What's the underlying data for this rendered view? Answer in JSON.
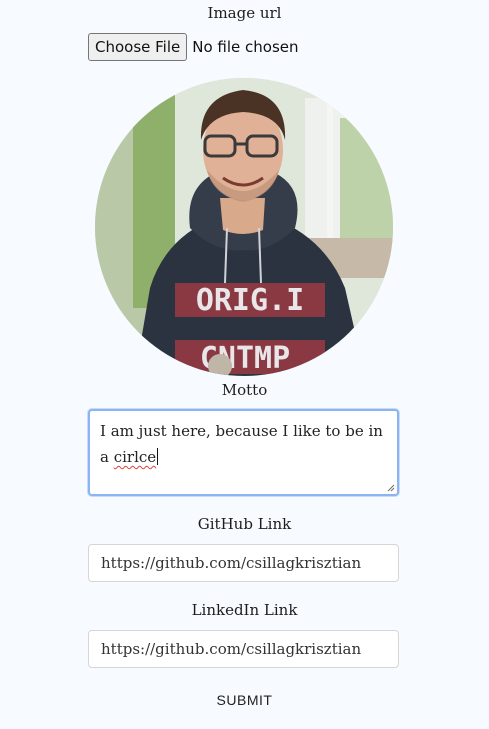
{
  "image_field": {
    "label": "Image url",
    "button_label": "Choose File",
    "status": "No file chosen"
  },
  "avatar": {
    "shirt_text_top": "ORIG.I",
    "shirt_text_bottom": "CNTMP"
  },
  "motto_field": {
    "label": "Motto",
    "value_text": "I am just here, because I like to be in a ",
    "value_misspelled": "cirlce"
  },
  "github_field": {
    "label": "GitHub Link",
    "value": "https://github.com/csillagkrisztian"
  },
  "linkedin_field": {
    "label": "LinkedIn Link",
    "value": "https://github.com/csillagkrisztian"
  },
  "submit_label": "SUBMIT",
  "colors": {
    "background": "#f7faff",
    "focus_border": "#8cb4f0",
    "hoodie": "#2c3340",
    "spellcheck": "#e0413a"
  }
}
